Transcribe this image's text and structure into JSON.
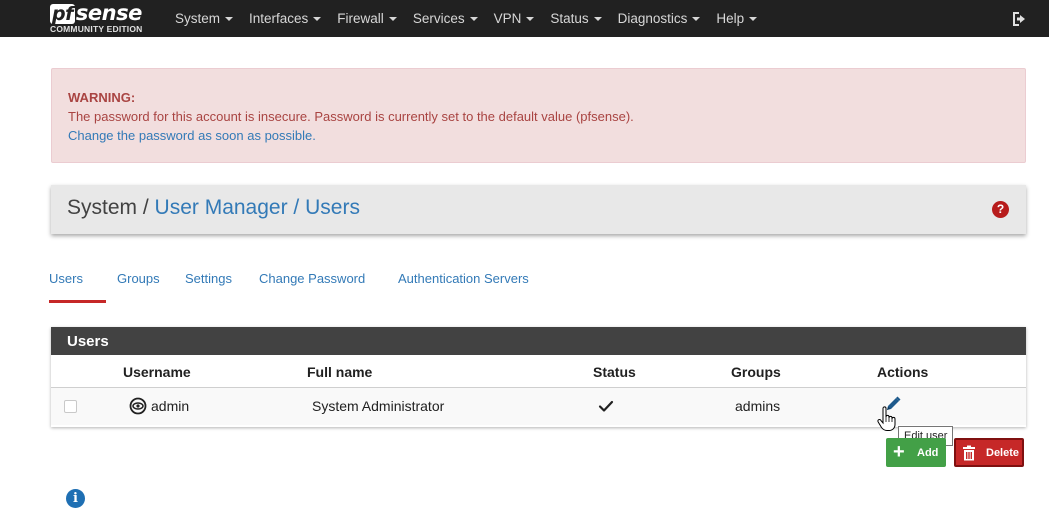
{
  "brand": {
    "logo_pf": "pf",
    "logo_rest": "sense",
    "edition": "COMMUNITY EDITION"
  },
  "nav": {
    "items": [
      "System",
      "Interfaces",
      "Firewall",
      "Services",
      "VPN",
      "Status",
      "Diagnostics",
      "Help"
    ]
  },
  "warning": {
    "title": "WARNING:",
    "message": "The password for this account is insecure. Password is currently set to the default value (pfsense).",
    "link": "Change the password as soon as possible."
  },
  "breadcrumb": {
    "root": "System /",
    "level1": "User Manager /",
    "level2": "Users"
  },
  "tabs": [
    "Users",
    "Groups",
    "Settings",
    "Change Password",
    "Authentication Servers"
  ],
  "panel": {
    "title": "Users",
    "columns": [
      "Username",
      "Full name",
      "Status",
      "Groups",
      "Actions"
    ],
    "rows": [
      {
        "username": "admin",
        "fullname": "System Administrator",
        "groups": "admins"
      }
    ]
  },
  "tooltip": "Edit user",
  "buttons": {
    "add": "Add",
    "delete": "Delete"
  },
  "colors": {
    "navbar": "#212121",
    "link": "#337ab7",
    "warning_text": "#a94442",
    "add_green": "#43a047",
    "delete_red": "#c62828"
  }
}
